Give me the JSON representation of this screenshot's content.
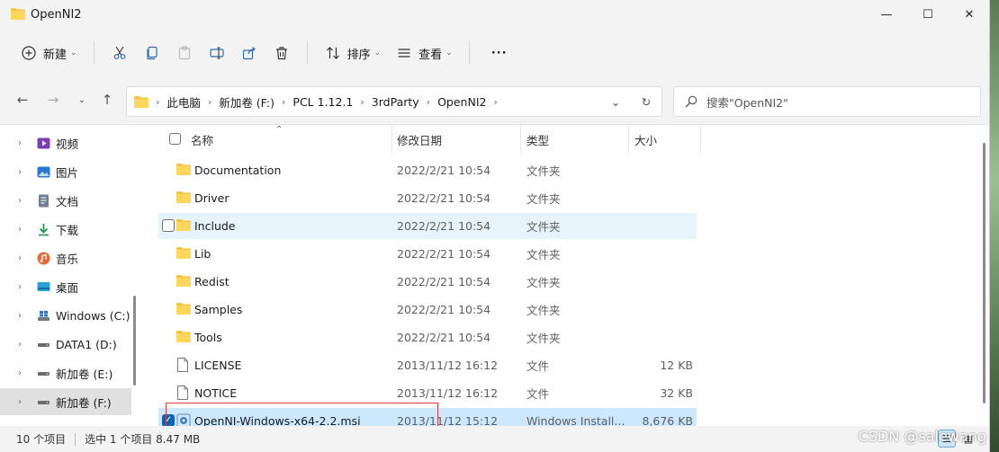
{
  "window": {
    "title": "OpenNI2"
  },
  "toolbar": {
    "new_label": "新建",
    "sort_label": "排序",
    "view_label": "查看",
    "more_label": "···"
  },
  "address": {
    "crumbs": [
      "此电脑",
      "新加卷 (F:)",
      "PCL 1.12.1",
      "3rdParty",
      "OpenNI2"
    ]
  },
  "search": {
    "placeholder": "搜索\"OpenNI2\""
  },
  "sidebar": {
    "items": [
      {
        "label": "视频",
        "icon": "video-icon"
      },
      {
        "label": "图片",
        "icon": "pictures-icon"
      },
      {
        "label": "文档",
        "icon": "documents-icon"
      },
      {
        "label": "下载",
        "icon": "download-icon"
      },
      {
        "label": "音乐",
        "icon": "music-icon"
      },
      {
        "label": "桌面",
        "icon": "desktop-icon"
      },
      {
        "label": "Windows (C:)",
        "icon": "drive-windows-icon"
      },
      {
        "label": "DATA1 (D:)",
        "icon": "drive-icon"
      },
      {
        "label": "新加卷 (E:)",
        "icon": "drive-icon"
      },
      {
        "label": "新加卷 (F:)",
        "icon": "drive-icon",
        "selected": true
      }
    ]
  },
  "columns": {
    "name": "名称",
    "date": "修改日期",
    "type": "类型",
    "size": "大小"
  },
  "files": [
    {
      "name": "Documentation",
      "date": "2022/2/21 10:54",
      "type": "文件夹",
      "size": "",
      "kind": "folder"
    },
    {
      "name": "Driver",
      "date": "2022/2/21 10:54",
      "type": "文件夹",
      "size": "",
      "kind": "folder"
    },
    {
      "name": "Include",
      "date": "2022/2/21 10:54",
      "type": "文件夹",
      "size": "",
      "kind": "folder",
      "state": "hover"
    },
    {
      "name": "Lib",
      "date": "2022/2/21 10:54",
      "type": "文件夹",
      "size": "",
      "kind": "folder"
    },
    {
      "name": "Redist",
      "date": "2022/2/21 10:54",
      "type": "文件夹",
      "size": "",
      "kind": "folder"
    },
    {
      "name": "Samples",
      "date": "2022/2/21 10:54",
      "type": "文件夹",
      "size": "",
      "kind": "folder"
    },
    {
      "name": "Tools",
      "date": "2022/2/21 10:54",
      "type": "文件夹",
      "size": "",
      "kind": "folder"
    },
    {
      "name": "LICENSE",
      "date": "2013/11/12 16:12",
      "type": "文件",
      "size": "12 KB",
      "kind": "file"
    },
    {
      "name": "NOTICE",
      "date": "2013/11/12 16:12",
      "type": "文件",
      "size": "32 KB",
      "kind": "file"
    },
    {
      "name": "OpenNI-Windows-x64-2.2.msi",
      "date": "2013/11/12 15:12",
      "type": "Windows Install...",
      "size": "8,676 KB",
      "kind": "msi",
      "state": "selected"
    }
  ],
  "status": {
    "count": "10 个项目",
    "selected": "选中 1 个项目  8.47 MB"
  },
  "watermark": "CSDN @salewang",
  "colors": {
    "accent": "#0067c0",
    "selected_row": "#cce8ff",
    "hover_row": "#e5f3fb",
    "folder": "#f4c542"
  }
}
